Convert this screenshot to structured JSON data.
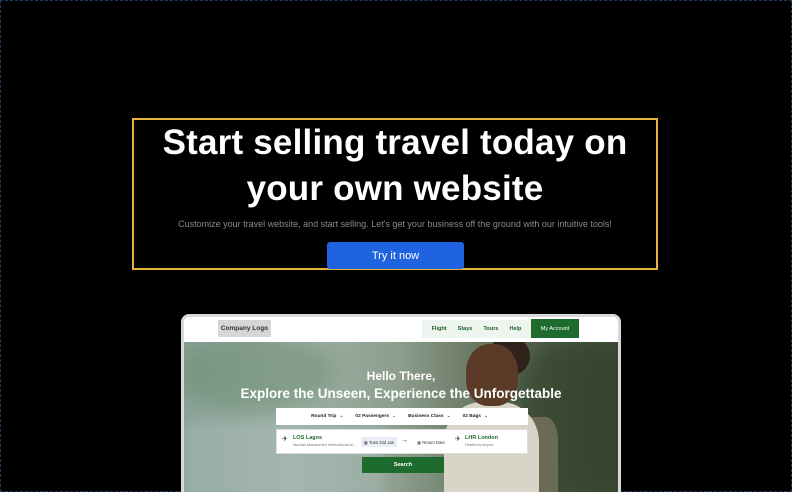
{
  "hero": {
    "headline": "Start selling travel today on your own website",
    "subtext": "Customize your travel website, and start selling. Let's get your business off the ground with our intuitive tools!",
    "cta_label": "Try it now"
  },
  "preview": {
    "logo": "Company Logo",
    "nav": [
      "Flight",
      "Stays",
      "Tours",
      "Help"
    ],
    "account_label": "My Account",
    "greeting": "Hello There,",
    "tagline": "Explore the Unseen, Experience the Unforgettable",
    "options": [
      {
        "label": "Round Trip",
        "icon": "chevron-down-icon"
      },
      {
        "label": "02 Passengers",
        "icon": "chevron-down-icon"
      },
      {
        "label": "Business Class",
        "icon": "chevron-down-icon"
      },
      {
        "label": "02 Bags",
        "icon": "chevron-down-icon"
      }
    ],
    "from": {
      "code": "LOS Lagos",
      "detail": "Murtala Muhammed International Ai..."
    },
    "depart_date": "Tues 2nd Jan",
    "return_date": "Return Date",
    "to": {
      "code": "LHR London",
      "detail": "Heathrow Airport"
    },
    "search_label": "Search"
  },
  "colors": {
    "cta_blue": "#1f63e0",
    "brand_green": "#1e6b2e",
    "highlight_border": "#e8b33a"
  }
}
